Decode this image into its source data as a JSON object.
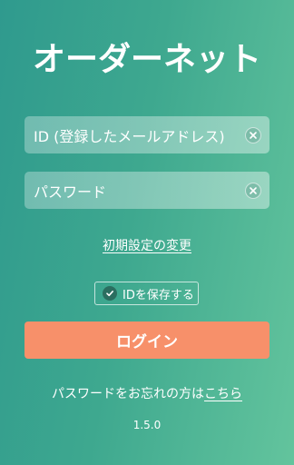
{
  "app": {
    "logo_text": "オーダーネット"
  },
  "form": {
    "id_placeholder": "ID (登録したメールアドレス)",
    "password_placeholder": "パスワード"
  },
  "links": {
    "initial_settings": "初期設定の変更",
    "forgot_prefix": "パスワードをお忘れの方は",
    "forgot_here": "こちら"
  },
  "remember": {
    "label": "IDを保存する",
    "checked": true
  },
  "buttons": {
    "login": "ログイン"
  },
  "version": "1.5.0",
  "colors": {
    "background_start": "#2f9a8e",
    "background_end": "#63c49d",
    "login_button": "#f7906a"
  },
  "icons": {
    "clear": "clear-x-icon",
    "check": "check-icon"
  }
}
